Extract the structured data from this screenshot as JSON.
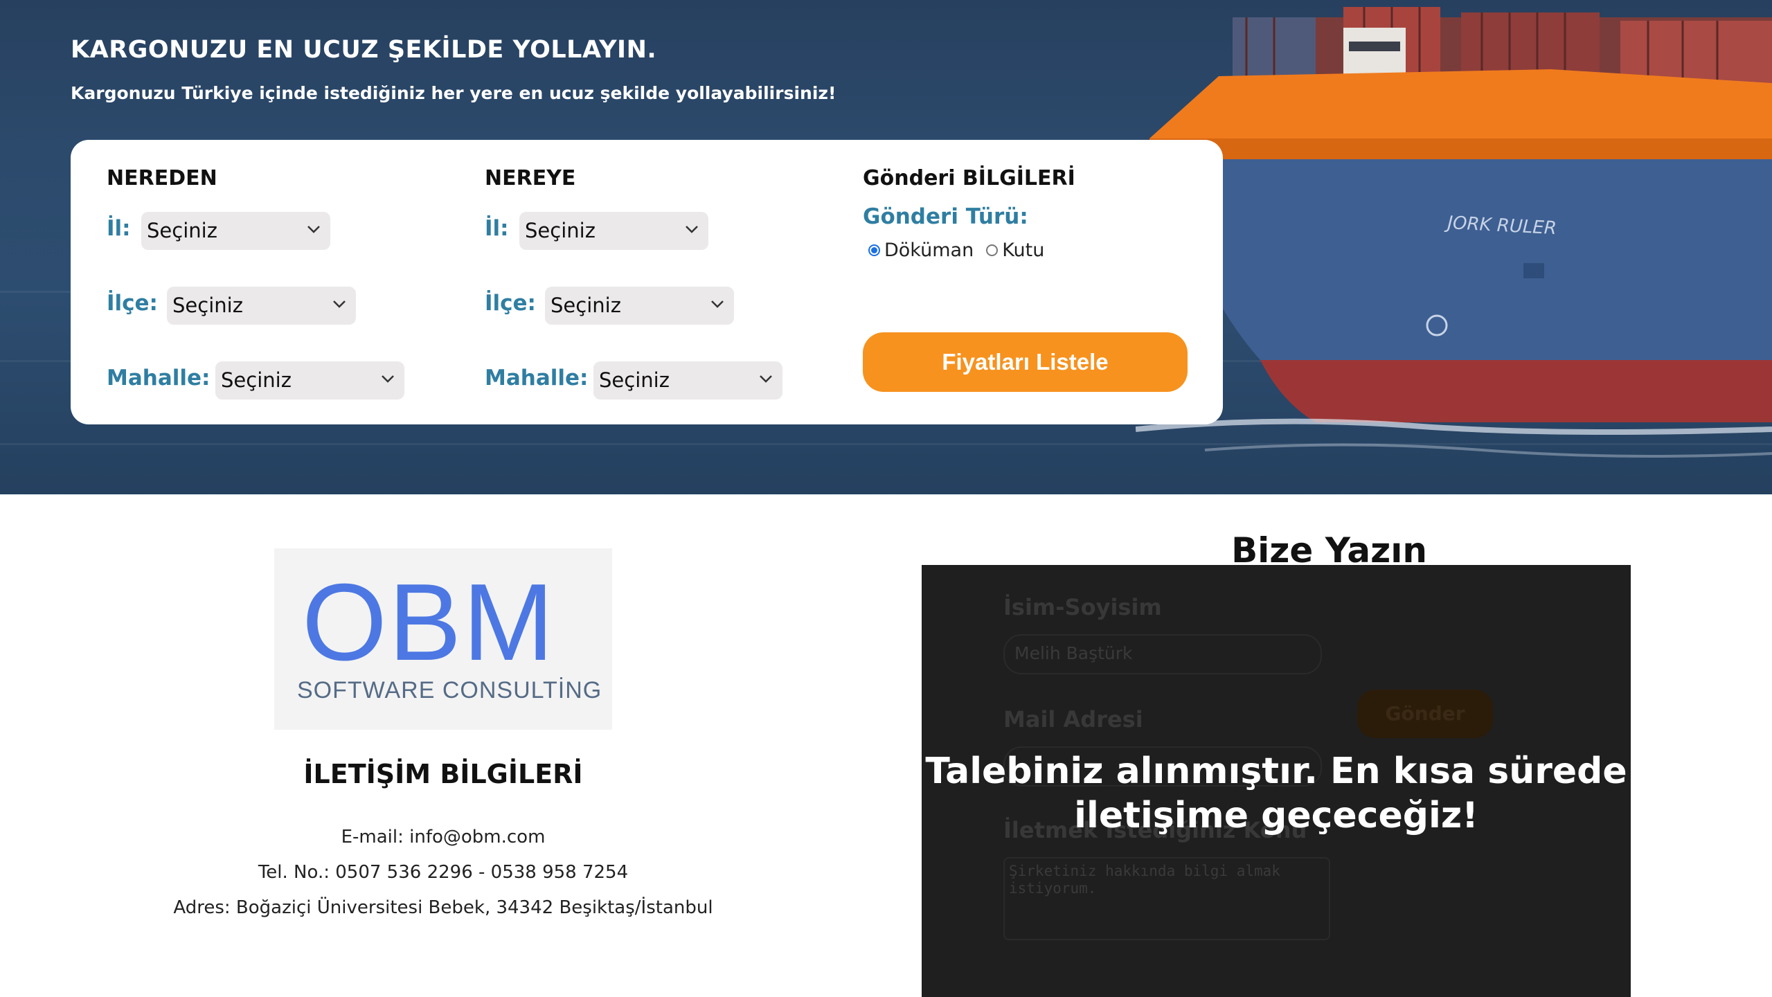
{
  "hero": {
    "title": "KARGONUZU EN UCUZ ŞEKİLDE YOLLAYIN.",
    "subtitle": "Kargonuzu Türkiye içinde istediğiniz her yere en ucuz şekilde yollayabilirsiniz!",
    "ship_name": "JORK RULER"
  },
  "from": {
    "title": "NEREDEN",
    "il_label": "İl:",
    "ilce_label": "İlçe:",
    "mahalle_label": "Mahalle:",
    "il_value": "Seçiniz",
    "ilce_value": "Seçiniz",
    "mahalle_value": "Seçiniz"
  },
  "to": {
    "title": "NEREYE",
    "il_label": "İl:",
    "ilce_label": "İlçe:",
    "mahalle_label": "Mahalle:",
    "il_value": "Seçiniz",
    "ilce_value": "Seçiniz",
    "mahalle_value": "Seçiniz"
  },
  "shipment": {
    "title": "Gönderi BİLGİLERİ",
    "type_label": "Gönderi Türü:",
    "option_document": "Döküman",
    "option_box": "Kutu",
    "selected": "Döküman",
    "list_button": "Fiyatları Listele"
  },
  "logo": {
    "big": "OBM",
    "small": "SOFTWARE CONSULTİNG"
  },
  "contact": {
    "title": "İLETİŞİM BİLGİLERİ",
    "email": "E-mail: info@obm.com",
    "phone": "Tel. No.: 0507 536 2296 - 0538 958 7254",
    "address": "Adres: Boğaziçi Üniversitesi Bebek, 34342 Beşiktaş/İstanbul"
  },
  "write": {
    "title": "Bize Yazın",
    "name_label": "İsim-Soyisim",
    "name_value": "Melih Baştürk",
    "mail_label": "Mail Adresi",
    "topic_label": "İletmek İstediğiniz Konu",
    "topic_value": "Şirketiniz hakkında bilgi almak istiyorum.",
    "send_button": "Gönder",
    "success_message": "Talebiniz alınmıştır. En kısa sürede iletişime geçeceğiz!"
  },
  "colors": {
    "accent_orange": "#f7921e",
    "label_teal": "#2f7ea2",
    "logo_blue": "#4d78e3",
    "overlay": "#1f1f1f"
  }
}
